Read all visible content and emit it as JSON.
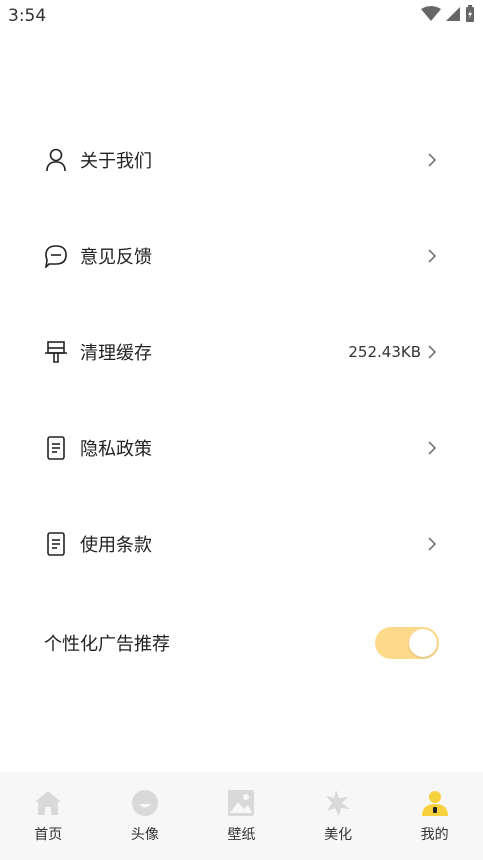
{
  "status_bar": {
    "time": "3:54"
  },
  "menu": {
    "items": [
      {
        "label": "关于我们",
        "icon": "user-icon",
        "value": ""
      },
      {
        "label": "意见反馈",
        "icon": "feedback-icon",
        "value": ""
      },
      {
        "label": "清理缓存",
        "icon": "brush-icon",
        "value": "252.43KB"
      },
      {
        "label": "隐私政策",
        "icon": "document-icon",
        "value": ""
      },
      {
        "label": "使用条款",
        "icon": "document-icon",
        "value": ""
      }
    ]
  },
  "personalized_ads": {
    "label": "个性化广告推荐",
    "enabled": true
  },
  "tab_bar": {
    "tabs": [
      {
        "label": "首页",
        "icon": "home-icon",
        "active": false
      },
      {
        "label": "头像",
        "icon": "avatar-icon",
        "active": false
      },
      {
        "label": "壁纸",
        "icon": "wallpaper-icon",
        "active": false
      },
      {
        "label": "美化",
        "icon": "beautify-icon",
        "active": false
      },
      {
        "label": "我的",
        "icon": "profile-icon",
        "active": true
      }
    ]
  },
  "colors": {
    "accent": "#fdd98a",
    "active_tab": "#f7d13b",
    "inactive_tab": "#d9d9d9"
  }
}
